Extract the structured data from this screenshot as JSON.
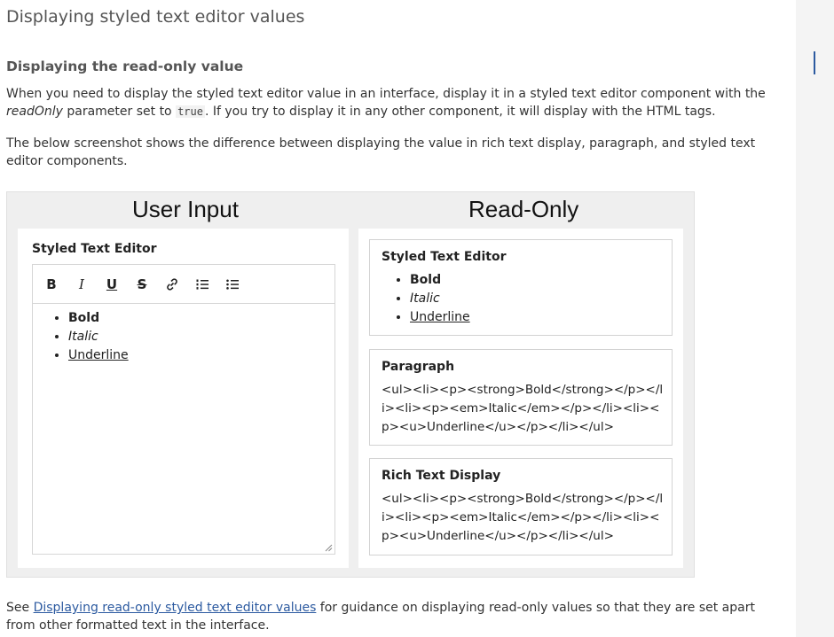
{
  "page": {
    "title": "Displaying styled text editor values",
    "section_title": "Displaying the read-only value",
    "para1": {
      "part1": "When you need to display the styled text editor value in an interface, display it in a styled text editor component with the ",
      "em": "readOnly",
      "part2": " parameter set to ",
      "code": "true",
      "part3": ". If you try to display it in any other component, it will display with the HTML tags."
    },
    "para2": "The below screenshot shows the difference between displaying the value in rich text display, paragraph, and styled text editor components.",
    "para3": {
      "prefix": "See ",
      "link": "Displaying read-only styled text editor values",
      "suffix": " for guidance on displaying read-only values so that they are set apart from other formatted text in the interface."
    }
  },
  "figure": {
    "left_heading": "User Input",
    "right_heading": "Read-Only",
    "editor": {
      "label": "Styled Text Editor",
      "toolbar": {
        "bold": "B",
        "italic": "I",
        "underline": "U",
        "strike": "S"
      },
      "items": [
        "Bold",
        "Italic",
        "Underline"
      ]
    },
    "cards": {
      "styled": {
        "title": "Styled Text Editor",
        "items": [
          "Bold",
          "Italic",
          "Underline"
        ]
      },
      "paragraph": {
        "title": "Paragraph",
        "text": "<ul><li><p><strong>Bold</strong></p></li><li><p><em>Italic</em></p></li><li><p><u>Underline</u></p></li></ul>"
      },
      "rich": {
        "title": "Rich Text Display",
        "text": "<ul><li><p><strong>Bold</strong></p></li><li><p><em>Italic</em></p></li><li><p><u>Underline</u></p></li></ul>"
      }
    }
  }
}
